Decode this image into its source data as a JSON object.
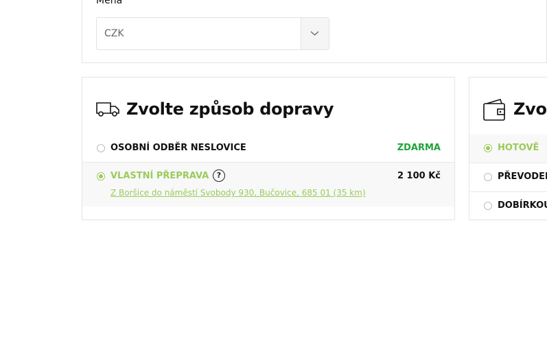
{
  "currency": {
    "label": "Měna",
    "selected": "CZK",
    "icon": "chevron-down-icon"
  },
  "shipping": {
    "title": "Zvolte způsob dopravy",
    "icon": "truck-icon",
    "options": [
      {
        "label": "OSOBNÍ ODBĚR NESLOVICE",
        "price": "ZDARMA",
        "selected": false
      },
      {
        "label": "VLASTNÍ PŘEPRAVA",
        "price": "2 100 Kč",
        "selected": true,
        "help_icon": "question-circle-icon",
        "address_link": "Z Boršice do náměstí Svobody 930, Bučovice, 685 01 (35 km)"
      }
    ]
  },
  "payment": {
    "title": "Zvol",
    "icon": "wallet-icon",
    "options": [
      {
        "label": "HOTOVĚ",
        "selected": true
      },
      {
        "label": "PŘEVODEM",
        "selected": false
      },
      {
        "label": "DOBÍRKOU",
        "selected": false
      }
    ]
  },
  "colors": {
    "accent_green": "#9acb5a",
    "free_green": "#1fa33a",
    "border": "#e4e4e4",
    "selected_row_bg": "#f8f8f8"
  }
}
